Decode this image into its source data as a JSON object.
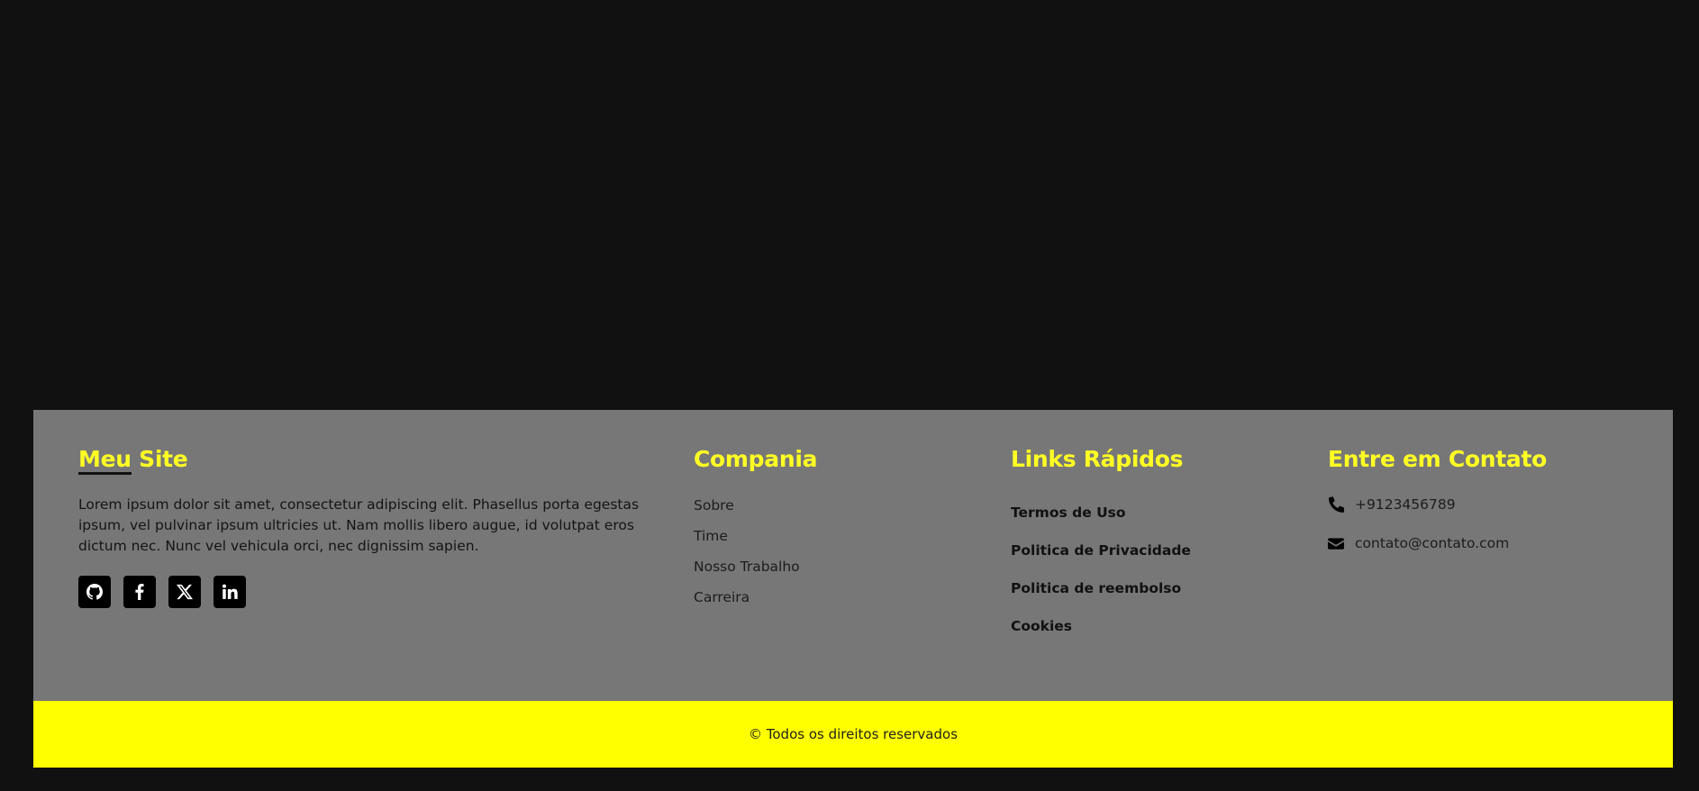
{
  "about": {
    "title_main": "Meu",
    "title_rest": " Site",
    "description": "Lorem ipsum dolor sit amet, consectetur adipiscing elit. Phasellus porta egestas ipsum, vel pulvinar ipsum ultricies ut. Nam mollis libero augue, id volutpat eros dictum nec. Nunc vel vehicula orci, nec dignissim sapien.",
    "socials": [
      "github-icon",
      "facebook-icon",
      "x-icon",
      "linkedin-icon"
    ]
  },
  "company": {
    "title": "Compania",
    "items": [
      "Sobre",
      "Time",
      "Nosso Trabalho",
      "Carreira"
    ]
  },
  "links": {
    "title": "Links Rápidos",
    "items": [
      "Termos de Uso",
      "Politica de Privacidade",
      "Politica de reembolso",
      "Cookies"
    ]
  },
  "contact": {
    "title": "Entre em Contato",
    "phone": "+9123456789",
    "email": "contato@contato.com"
  },
  "footer": {
    "copyright": "© Todos os direitos reservados"
  },
  "colors": {
    "background": "#111112",
    "footer_bg": "#777777",
    "accent": "#ffff00",
    "heading": "#ffff24"
  }
}
